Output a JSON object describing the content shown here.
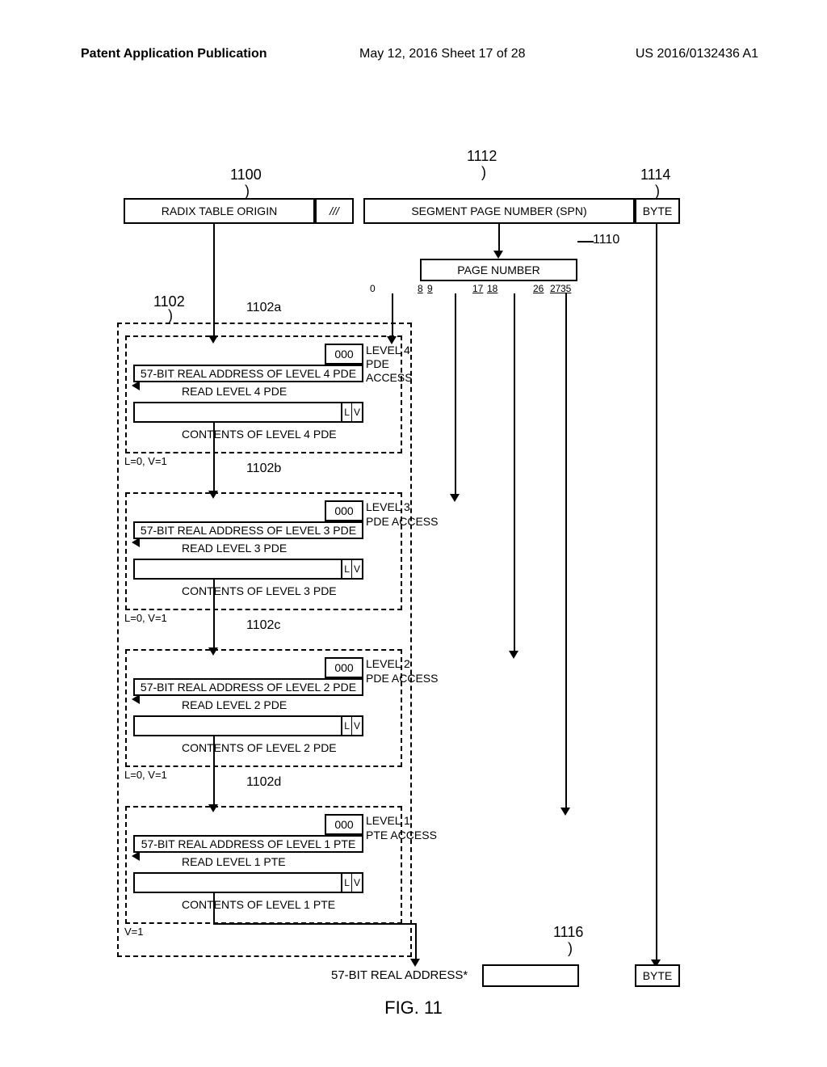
{
  "header": {
    "left": "Patent Application Publication",
    "middle": "May 12, 2016  Sheet 17 of 28",
    "pubnum": "US 2016/0132436 A1"
  },
  "refs": {
    "r1100": "1100",
    "r1102": "1102",
    "r1102a": "1102a",
    "r1102b": "1102b",
    "r1102c": "1102c",
    "r1102d": "1102d",
    "r1110": "1110",
    "r1112": "1112",
    "r1114": "1114",
    "r1116": "1116"
  },
  "top_boxes": {
    "radix": "RADIX TABLE ORIGIN",
    "slashes": "///",
    "spn": "SEGMENT PAGE NUMBER (SPN)",
    "byte": "BYTE"
  },
  "page_number": {
    "title": "PAGE NUMBER",
    "ticks": {
      "t0": "0",
      "t8": "8",
      "t9": "9",
      "t17": "17",
      "t18": "18",
      "t26": "26",
      "t27": "27",
      "t35": "35"
    }
  },
  "levels": {
    "l4": {
      "suffix": "000",
      "addr": "57-BIT REAL ADDRESS OF LEVEL 4 PDE",
      "read": "READ LEVEL 4 PDE",
      "contents": "CONTENTS OF LEVEL 4 PDE",
      "access1": "LEVEL 4",
      "access2": "PDE",
      "access3": "ACCESS",
      "lv": "L=0, V=1",
      "l": "L",
      "v": "V"
    },
    "l3": {
      "suffix": "000",
      "addr": "57-BIT REAL ADDRESS OF LEVEL 3 PDE",
      "read": "READ LEVEL 3 PDE",
      "contents": "CONTENTS OF LEVEL 3 PDE",
      "access": "LEVEL 3\nPDE ACCESS",
      "lv": "L=0, V=1",
      "l": "L",
      "v": "V"
    },
    "l2": {
      "suffix": "000",
      "addr": "57-BIT REAL ADDRESS OF LEVEL 2 PDE",
      "read": "READ LEVEL 2 PDE",
      "contents": "CONTENTS OF LEVEL 2 PDE",
      "access": "LEVEL 2\nPDE ACCESS",
      "lv": "L=0, V=1",
      "l": "L",
      "v": "V"
    },
    "l1": {
      "suffix": "000",
      "addr": "57-BIT REAL ADDRESS OF LEVEL 1 PTE",
      "read": "READ LEVEL 1 PTE",
      "contents": "CONTENTS OF LEVEL 1 PTE",
      "access": "LEVEL 1\nPTE ACCESS",
      "lv": "V=1",
      "l": "L",
      "v": "V"
    }
  },
  "bottom": {
    "addr": "57-BIT REAL ADDRESS*",
    "byte": "BYTE"
  },
  "fig": "FIG. 11"
}
